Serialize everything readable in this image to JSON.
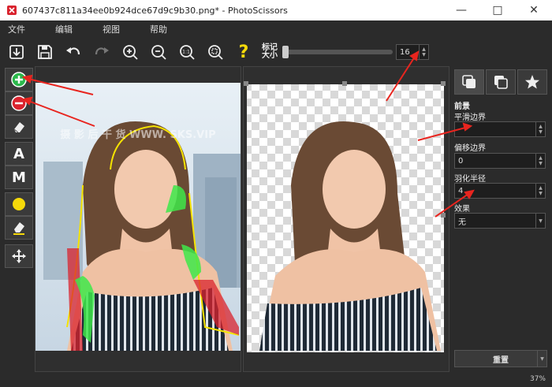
{
  "window": {
    "title": "607437c811a34ee0b924dce67d9c9b30.png* - PhotoScissors"
  },
  "menu": [
    "文件",
    "编辑",
    "视图",
    "帮助"
  ],
  "toolbar": {
    "size_label": "标记\n大小",
    "size_value": "16",
    "help_glyph": "?"
  },
  "left_tools": {
    "auto_label": "A",
    "manual_label": "M"
  },
  "watermark": "摄 影 后 干 货   WWW.  SKS.VIP",
  "right_panel": {
    "section_title": "前景",
    "smooth_label": "平滑边界",
    "smooth_value": "",
    "offset_label": "偏移边界",
    "offset_value": "0",
    "feather_label": "羽化半径",
    "feather_value": "4",
    "effect_label": "效果",
    "effect_value": "无",
    "reset_label": "重置"
  },
  "status": {
    "zoom": "37%"
  },
  "colors": {
    "accent_green": "#2bb84b",
    "accent_red": "#d9232e",
    "yellow": "#f5d90a",
    "arrow_red": "#e8251f"
  }
}
